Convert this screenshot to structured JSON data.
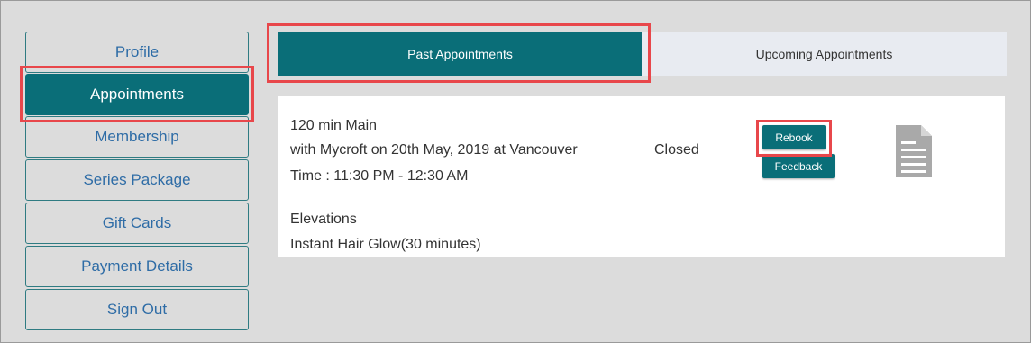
{
  "sidebar": {
    "items": [
      {
        "label": "Profile"
      },
      {
        "label": "Appointments",
        "active": true
      },
      {
        "label": "Membership"
      },
      {
        "label": "Series Package"
      },
      {
        "label": "Gift Cards"
      },
      {
        "label": "Payment Details"
      },
      {
        "label": "Sign Out"
      }
    ]
  },
  "tabs": {
    "past": "Past Appointments",
    "upcoming": "Upcoming Appointments"
  },
  "appointment": {
    "service": "120 min Main",
    "with_line": "with Mycroft on 20th May, 2019 at Vancouver",
    "time": "Time : 11:30 PM - 12:30 AM",
    "location": "Elevations",
    "addon": "Instant Hair Glow(30 minutes)",
    "status": "Closed",
    "rebook_label": "Rebook",
    "feedback_label": "Feedback",
    "invoice_icon": "document-icon"
  },
  "colors": {
    "accent": "#0a6e78",
    "link": "#2e6ca6",
    "highlight": "#e8474b",
    "background": "#dcdcdc"
  }
}
